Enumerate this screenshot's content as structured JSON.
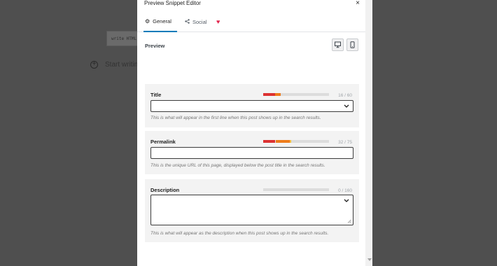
{
  "background": {
    "html_block_text": "write HTML",
    "add_block_glyph": "+",
    "start_writing": "Start writing"
  },
  "modal": {
    "title": "Preview Snippet Editor",
    "close_glyph": "×"
  },
  "tabs": [
    {
      "label": "General",
      "icon": "gear-icon",
      "active": true
    },
    {
      "label": "Social",
      "icon": "share-icon",
      "active": false
    },
    {
      "label": "",
      "icon": "heart-icon",
      "active": false
    }
  ],
  "tab_glyphs": {
    "general": "⚙",
    "social": "<",
    "heart": "♥"
  },
  "preview": {
    "label": "Preview",
    "device_buttons": [
      "desktop-icon",
      "mobile-icon"
    ]
  },
  "fields": {
    "title": {
      "label": "Title",
      "count": "16 / 60",
      "value": "",
      "help": "This is what will appear in the first line when this post shows up in the search results."
    },
    "permalink": {
      "label": "Permalink",
      "count": "32 / 75",
      "value": "",
      "help": "This is the unique URL of this page, displayed below the post title in the search results."
    },
    "description": {
      "label": "Description",
      "count": "0 / 160",
      "value": "",
      "help": "This is what will appear as the description when this post shows up in the search results."
    }
  },
  "colors": {
    "accent": "#007cba",
    "heart": "#e2264d",
    "meter_red": "#dc3232",
    "meter_orange": "#ee7c1b",
    "meter_track": "#dcdcdc"
  }
}
